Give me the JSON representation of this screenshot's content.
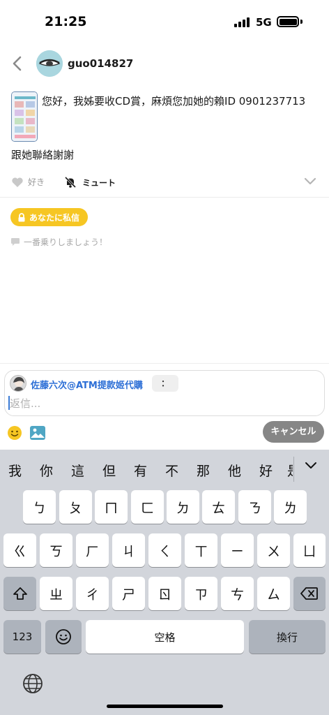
{
  "status_bar": {
    "time": "21:25",
    "network": "5G"
  },
  "header": {
    "username": "guo014827"
  },
  "post": {
    "text_line1": "您好，我姊要收CD賞，麻煩您加她的賴ID 0901237713",
    "text_line2": "跟她聯絡謝謝",
    "like_label": "好き",
    "mute_label": "ミュート"
  },
  "private_badge": "あなたに私信",
  "first_reply_hint": "一番乗りしましょう！",
  "composer": {
    "mention_name": "佐藤六次@ATM提款姬代購",
    "more_label": "：",
    "placeholder": "返信...",
    "cancel_label": "キャンセル"
  },
  "keyboard": {
    "candidates": [
      "我",
      "你",
      "這",
      "但",
      "有",
      "不",
      "那",
      "他",
      "好",
      "是"
    ],
    "row1": [
      "ㄅ",
      "ㄆ",
      "ㄇ",
      "ㄈ",
      "ㄉ",
      "ㄊ",
      "ㄋ",
      "ㄌ"
    ],
    "row2": [
      "ㄍ",
      "ㄎ",
      "ㄏ",
      "ㄐ",
      "ㄑ",
      "ㄒ",
      "ㄧ",
      "ㄨ",
      "ㄩ"
    ],
    "row3": [
      "ㄓ",
      "ㄔ",
      "ㄕ",
      "ㄖ",
      "ㄗ",
      "ㄘ",
      "ㄙ"
    ],
    "numbers_label": "123",
    "space_label": "空格",
    "return_label": "換行"
  },
  "icons": {
    "back": "chevron-left-icon",
    "like": "heart-icon",
    "mute": "bell-slash-icon",
    "expand": "chevron-down-icon",
    "lock": "lock-icon",
    "comment": "chat-bubble-icon",
    "emoji": "smiley-icon",
    "image": "image-icon",
    "shift": "shift-icon",
    "delete": "backspace-icon",
    "globe": "globe-icon"
  },
  "colors": {
    "badge": "#f6c623",
    "mention": "#2d6fd6",
    "cancel": "#868686",
    "keyboard_bg": "#d2d5db"
  }
}
